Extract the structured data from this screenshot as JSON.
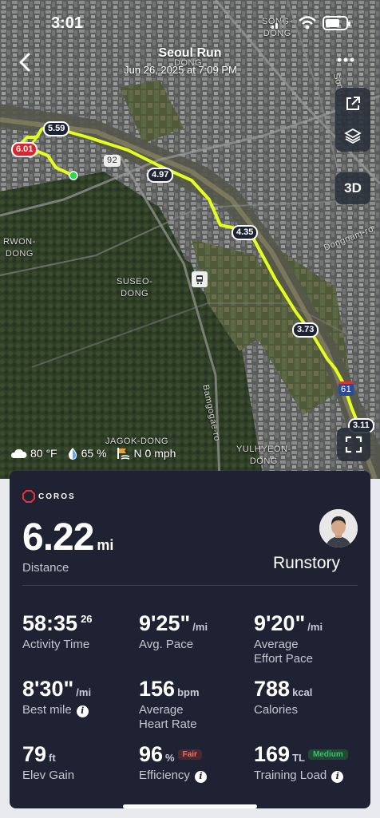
{
  "status_bar": {
    "time": "3:01"
  },
  "header": {
    "title": "Seoul Run",
    "subtitle": "Jun 26, 2025 at 7:09 PM"
  },
  "map": {
    "labels": {
      "songdong": "SONG-\nDONG",
      "songdong2": "DONG",
      "rwon": "RWON-\nDONG",
      "suseo": "SUSEO-\nDONG",
      "jagok": "JAGOK-DONG",
      "yulhyeon": "YULHYEON-\nDONG",
      "bamgogae": "Bamgogae-ro",
      "dongnam": "Dongnam-ro",
      "song_road": "Song",
      "route_92": "92",
      "route_61": "61"
    },
    "pace_markers": [
      "6.01",
      "5.59",
      "4.97",
      "4.35",
      "3.73",
      "3.11"
    ],
    "btn_3d": "3D",
    "route_color": "#e4ff1e"
  },
  "weather": {
    "temp": "80 °F",
    "humidity": "65 %",
    "wind": "N 0 mph"
  },
  "summary": {
    "brand": "COROS",
    "distance_value": "6.22",
    "distance_unit": "mi",
    "distance_label": "Distance",
    "runstory": "Runstory",
    "metrics": {
      "activity_time": {
        "value": "58:35",
        "sup": "26",
        "label": "Activity Time"
      },
      "avg_pace": {
        "value": "9'25\"",
        "unit": "/mi",
        "label": "Avg. Pace"
      },
      "effort_pace": {
        "value": "9'20\"",
        "unit": "/mi",
        "label": "Average\nEffort Pace"
      },
      "best_mile": {
        "value": "8'30\"",
        "unit": "/mi",
        "label": "Best mile"
      },
      "heart_rate": {
        "value": "156",
        "unit": "bpm",
        "label": "Average\nHeart Rate"
      },
      "calories": {
        "value": "788",
        "unit": "kcal",
        "label": "Calories"
      },
      "elev_gain": {
        "value": "79",
        "unit": "ft",
        "label": "Elev Gain"
      },
      "efficiency": {
        "value": "96",
        "unit": "%",
        "badge": "Fair",
        "label": "Efficiency"
      },
      "training_load": {
        "value": "169",
        "unit": "TL",
        "badge": "Medium",
        "label": "Training Load"
      }
    },
    "colors": {
      "card_bg": "#1e2232",
      "fair_badge": "#ff6a5c",
      "medium_badge": "#35c46a"
    }
  }
}
